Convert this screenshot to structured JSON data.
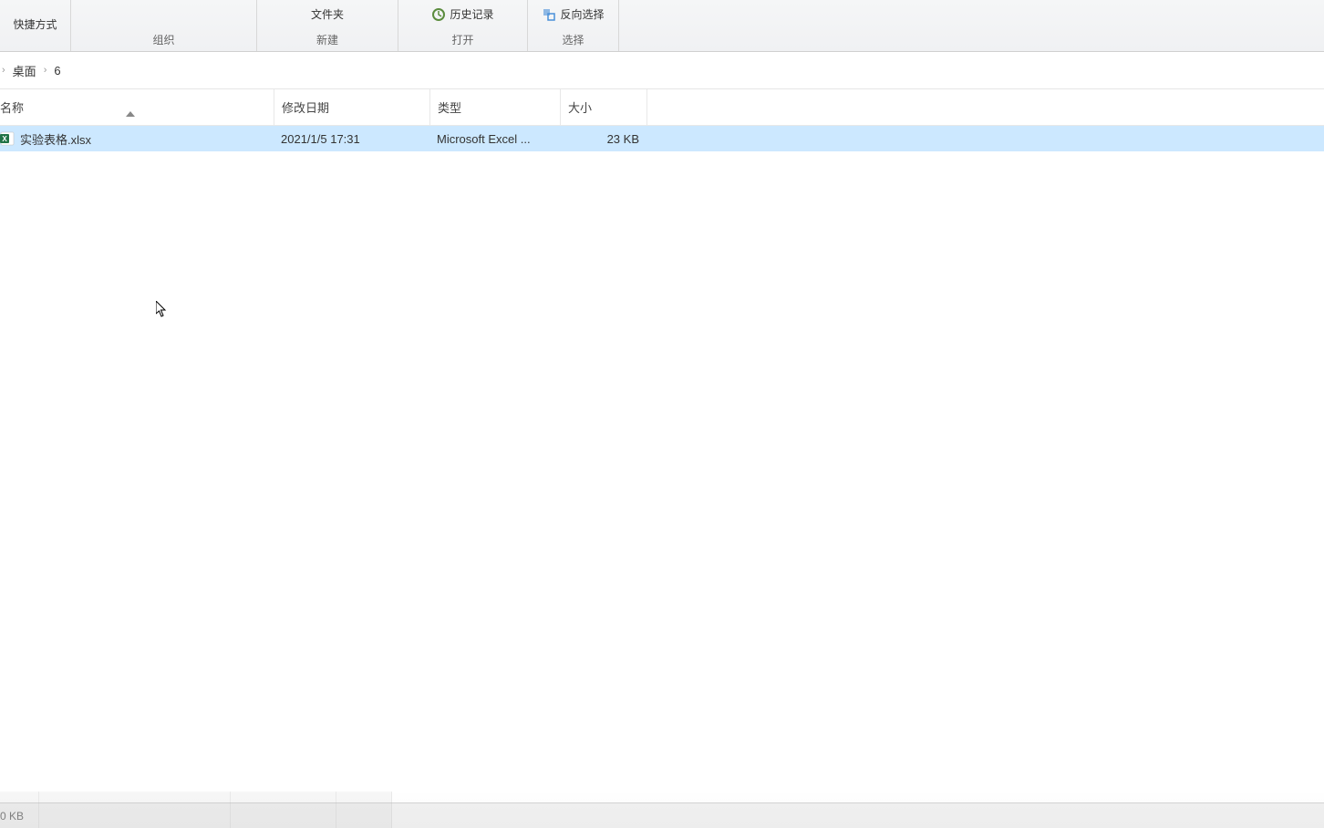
{
  "ribbon": {
    "shortcut_partial": "快捷方式",
    "folder": "文件夹",
    "history": "历史记录",
    "invert_selection": "反向选择",
    "groups": {
      "organize": "组织",
      "new": "新建",
      "open": "打开",
      "select": "选择"
    }
  },
  "breadcrumb": {
    "desktop": "桌面",
    "folder": "6"
  },
  "columns": {
    "name": "名称",
    "modified": "修改日期",
    "type": "类型",
    "size": "大小"
  },
  "files": [
    {
      "name": "实验表格.xlsx",
      "modified": "2021/1/5 17:31",
      "type": "Microsoft Excel ...",
      "size": "23 KB"
    }
  ],
  "status": {
    "size_partial": "0 KB"
  }
}
